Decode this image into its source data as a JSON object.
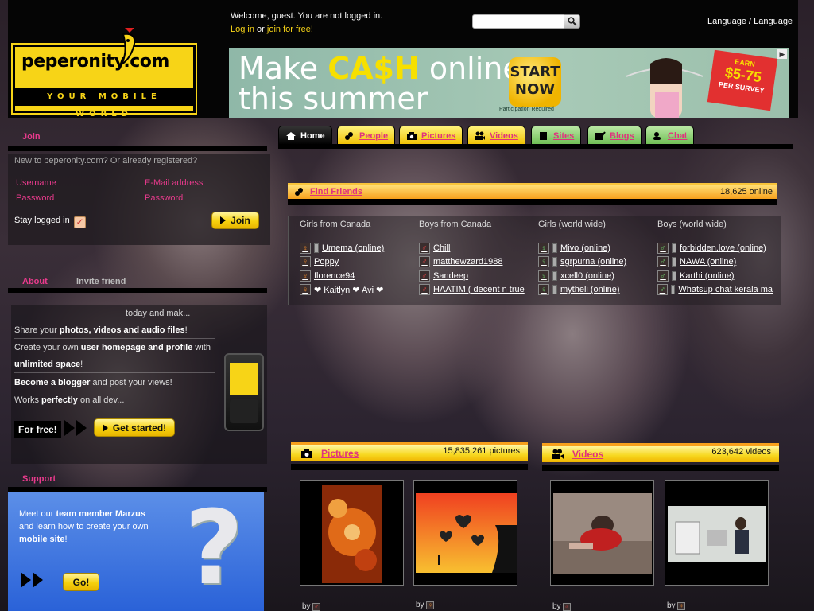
{
  "header": {
    "logo_text": "peperonity.com",
    "logo_tagline": "YOUR MOBILE WORLD",
    "welcome": "Welcome, guest. You are not logged in.",
    "login_link": "Log in",
    "or": "or",
    "join_link": "join for free!",
    "search_placeholder": "",
    "language_link": "Language / Language"
  },
  "banner": {
    "line1_a": "Make ",
    "line1_cash": "CA$H",
    "line1_b": " online",
    "line2": "this summer",
    "start": "START NOW",
    "participation": "Participation Required",
    "earn_label": "EARN",
    "earn_amount": "$5-75",
    "earn_per": "PER SURVEY"
  },
  "join": {
    "title": "Join",
    "new_text": "New to peperonity.com? Or already registered?",
    "username_label": "Username",
    "email_label": "E-Mail address",
    "password_label": "Password",
    "password_label2": "Password",
    "stay_logged_in": "Stay logged in",
    "join_button": "Join"
  },
  "about": {
    "tab_about": "About",
    "tab_invite": "Invite friend",
    "partial_line": "today and mak...",
    "lines": [
      {
        "pre": "Share your ",
        "bold": "photos, videos and audio files",
        "post": "!"
      },
      {
        "pre": "Create your own ",
        "bold": "user homepage and profile",
        "post": " with"
      },
      {
        "pre": "",
        "bold": "unlimited space",
        "post": "!"
      },
      {
        "pre": "",
        "bold": "Become a blogger",
        "post": " and post your views!"
      },
      {
        "pre": "Works ",
        "bold": "perfectly",
        "post": " on all dev..."
      }
    ],
    "for_free": "For free!",
    "get_started": "Get started!"
  },
  "support": {
    "title": "Support",
    "text_pre": "Meet our ",
    "text_bold": "team member Marzus",
    "text_mid": " and learn how to create your own ",
    "text_bold2": "mobile site",
    "text_post": "!",
    "go_button": "Go!"
  },
  "nav": {
    "tabs": [
      {
        "label": "Home",
        "style": "home"
      },
      {
        "label": "People",
        "style": "yellow"
      },
      {
        "label": "Pictures",
        "style": "yellow"
      },
      {
        "label": "Videos",
        "style": "yellow"
      },
      {
        "label": "Sites",
        "style": "green"
      },
      {
        "label": "Blogs",
        "style": "green"
      },
      {
        "label": "Chat",
        "style": "green"
      }
    ]
  },
  "find_friends": {
    "title": "Find Friends",
    "online": "18,625 online",
    "columns": [
      {
        "title": "Girls from Canada",
        "gender": "f",
        "items": [
          "Umema (online)",
          "Poppy",
          "florence94",
          "❤ Kaitlyn ❤ Avi ❤"
        ]
      },
      {
        "title": "Boys from Canada",
        "gender": "m",
        "items": [
          "Chill",
          "matthewzard1988",
          "Sandeep",
          "HAATIM ( decent n true"
        ]
      },
      {
        "title": "Girls (world wide)",
        "gender": "g",
        "items": [
          "Mivo (online)",
          "sgrpurna (online)",
          "xcell0 (online)",
          "mytheli (online)"
        ]
      },
      {
        "title": "Boys (world wide)",
        "gender": "g",
        "items": [
          "forbidden.love (online)",
          "NAWA (online)",
          "Karthi (online)",
          "Whatsup chat kerala ma"
        ]
      }
    ]
  },
  "pictures": {
    "title": "Pictures",
    "count": "15,835,261 pictures",
    "by": "by"
  },
  "videos": {
    "title": "Videos",
    "count": "623,642 videos",
    "by": "by"
  },
  "colors": {
    "accent_pink": "#e0327e",
    "brand_yellow": "#f7d417",
    "support_blue": "#2a62d8"
  }
}
